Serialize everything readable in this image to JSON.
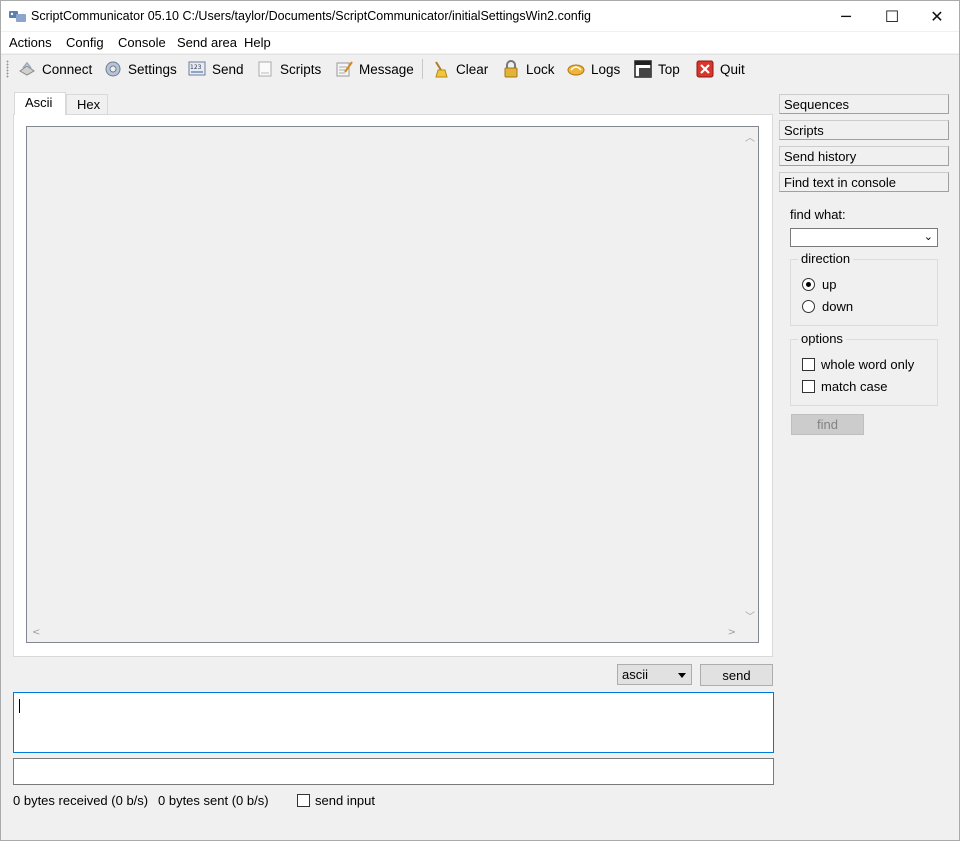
{
  "window": {
    "title": "ScriptCommunicator 05.10   C:/Users/taylor/Documents/ScriptCommunicator/initialSettingsWin2.config",
    "minimize_glyph": "─",
    "maximize_glyph": "☐",
    "close_glyph": "✕"
  },
  "menu": {
    "items": [
      "Actions",
      "Config",
      "Console",
      "Send area",
      "Help"
    ]
  },
  "toolbar": {
    "buttons": [
      {
        "label": "Connect",
        "icon": "connect-icon"
      },
      {
        "label": "Settings",
        "icon": "gear-icon"
      },
      {
        "label": "Send",
        "icon": "send-icon"
      },
      {
        "label": "Scripts",
        "icon": "scripts-icon"
      },
      {
        "label": "Message",
        "icon": "message-icon"
      },
      {
        "label": "Clear",
        "icon": "broom-icon"
      },
      {
        "label": "Lock",
        "icon": "lock-icon"
      },
      {
        "label": "Logs",
        "icon": "logs-icon"
      },
      {
        "label": "Top",
        "icon": "window-top-icon"
      },
      {
        "label": "Quit",
        "icon": "quit-icon"
      }
    ]
  },
  "console": {
    "tabs": [
      "Ascii",
      "Hex"
    ],
    "active_tab": "Ascii",
    "content": ""
  },
  "send": {
    "format_value": "ascii",
    "send_label": "send",
    "input_value": "",
    "second_input_value": ""
  },
  "status": {
    "received": "0 bytes received (0 b/s)",
    "sent": "0 bytes sent (0 b/s)",
    "send_input_label": "send input"
  },
  "right_panel": {
    "headers": [
      "Sequences",
      "Scripts",
      "Send history",
      "Find text in console"
    ],
    "find_what_label": "find what:",
    "find_what_value": "",
    "direction_title": "direction",
    "direction_up": "up",
    "direction_down": "down",
    "direction_selected": "up",
    "options_title": "options",
    "whole_word_label": "whole word only",
    "match_case_label": "match case",
    "find_label": "find"
  },
  "colors": {
    "focus_border": "#0078d7",
    "window_bg": "#f0f0f0"
  }
}
